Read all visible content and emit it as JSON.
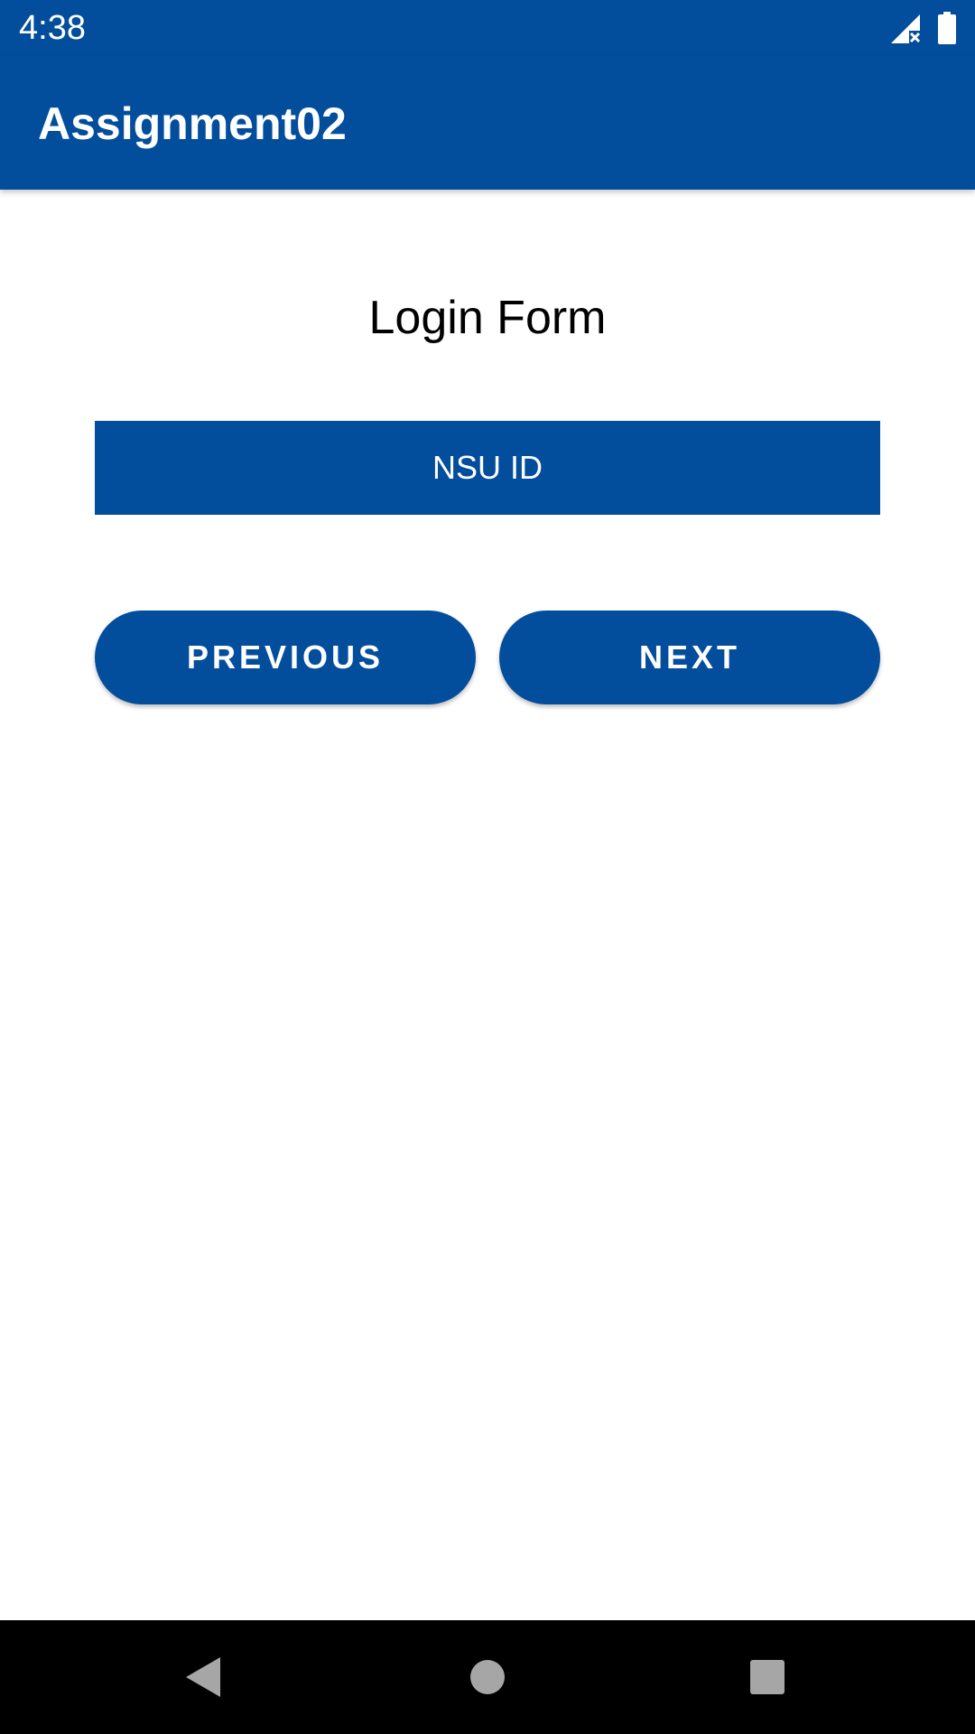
{
  "status_bar": {
    "time": "4:38",
    "icons": [
      "signal-no-data-icon",
      "battery-icon"
    ],
    "color": "#034e9c"
  },
  "app_bar": {
    "title": "Assignment02",
    "color": "#034e9c"
  },
  "form": {
    "title": "Login Form",
    "id_field": {
      "placeholder": "NSU ID",
      "value": ""
    },
    "previous_label": "PREVIOUS",
    "next_label": "NEXT"
  },
  "nav_bar": {
    "buttons": [
      "back-icon",
      "home-icon",
      "recents-icon"
    ]
  },
  "colors": {
    "primary": "#034e9c",
    "on_primary": "#ffffff",
    "background": "#ffffff",
    "nav_bar": "#000000",
    "nav_icon": "#a6a6a6"
  }
}
